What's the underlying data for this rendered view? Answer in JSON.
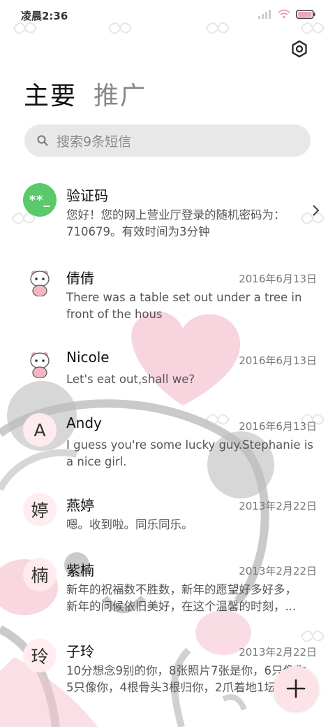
{
  "status_bar": {
    "time": "凌晨2:36"
  },
  "tabs": [
    {
      "label": "主要",
      "active": true
    },
    {
      "label": "推广",
      "active": false
    }
  ],
  "search": {
    "placeholder": "搜索9条短信"
  },
  "conversations": [
    {
      "avatar_text": "**_",
      "avatar_type": "verification",
      "name": "验证码",
      "date": "",
      "preview_lines": [
        "您好！您的网上营业厅登录的随机密码为：",
        "710679。有效时间为3分钟"
      ]
    },
    {
      "avatar_type": "panda-sticker",
      "name": "倩倩",
      "date": "2016年6月13日",
      "preview_lines": [
        "There was a table set out under a tree in",
        "front of the hous"
      ]
    },
    {
      "avatar_type": "panda-sticker",
      "name": "Nicole",
      "date": "2016年6月13日",
      "preview_lines": [
        "Let's eat out,shall we?"
      ]
    },
    {
      "avatar_text": "A",
      "avatar_type": "letter",
      "name": "Andy",
      "date": "2016年6月13日",
      "preview_lines": [
        "I guess you're some lucky guy.Stephanie is",
        "a nice girl."
      ]
    },
    {
      "avatar_text": "婷",
      "avatar_type": "letter",
      "name": "燕婷",
      "date": "2013年2月22日",
      "preview_lines": [
        "嗯。收到啦。同乐同乐。"
      ]
    },
    {
      "avatar_text": "楠",
      "avatar_type": "letter",
      "name": "紫楠",
      "date": "2013年2月22日",
      "preview_lines": [
        "新年的祝福数不胜数，新年的愿望好多好多，",
        "新年的问候依旧美好，在这个温馨的时刻，..."
      ]
    },
    {
      "avatar_text": "玲",
      "avatar_type": "letter",
      "name": "子玲",
      "date": "2013年2月22日",
      "preview_lines": [
        "10分想念9别的你，8张照片7张是你，6只像你",
        "5只像你，4根骨头3根归你，2爪着地1坛你"
      ]
    }
  ],
  "colors": {
    "accent_green": "#59c96b",
    "fab_bg": "#fde3e8",
    "heart": "#f7c6d3"
  },
  "icons": {
    "settings": "gear-icon",
    "search": "search-icon",
    "compose": "plus-icon"
  }
}
